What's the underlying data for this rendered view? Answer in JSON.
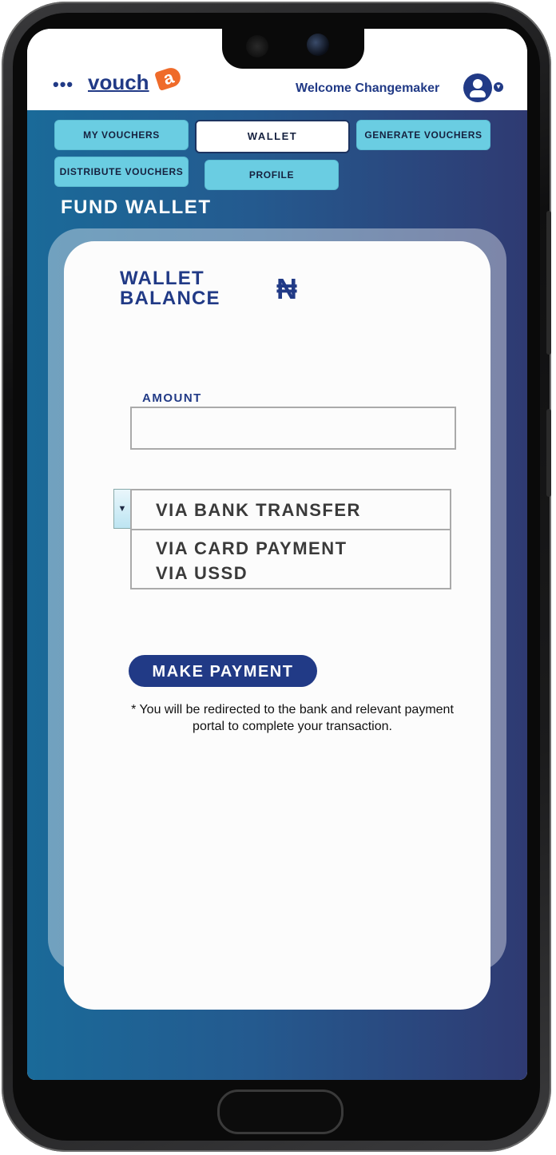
{
  "header": {
    "menu_dots": "•••",
    "logo_main": "vouch",
    "logo_tag": "a",
    "welcome": "Welcome Changemaker"
  },
  "tabs": [
    {
      "label": "MY VOUCHERS",
      "active": false
    },
    {
      "label": "WALLET",
      "active": true
    },
    {
      "label": "GENERATE VOUCHERS",
      "active": false
    },
    {
      "label": "DISTRIBUTE VOUCHERS",
      "active": false
    },
    {
      "label": "PROFILE",
      "active": false
    }
  ],
  "page_title": "FUND WALLET",
  "wallet": {
    "label_line1": "WALLET",
    "label_line2": "BALANCE",
    "currency_symbol": "₦"
  },
  "form": {
    "amount_label": "AMOUNT",
    "amount_value": "",
    "payment_method_selected": "VIA BANK TRANSFER",
    "payment_method_options": [
      "VIA BANK TRANSFER",
      "VIA CARD PAYMENT",
      "VIA USSD"
    ],
    "dropdown_arrow": "▼"
  },
  "actions": {
    "make_payment": "MAKE PAYMENT"
  },
  "note": "* You will be redirected to the bank and relevant payment portal to complete your transaction.",
  "colors": {
    "brand_navy": "#213a86",
    "tab_bg": "#6acde2",
    "logo_accent": "#ef6b2a",
    "gradient_start": "#1a6a99",
    "gradient_end": "#2f3a72"
  }
}
